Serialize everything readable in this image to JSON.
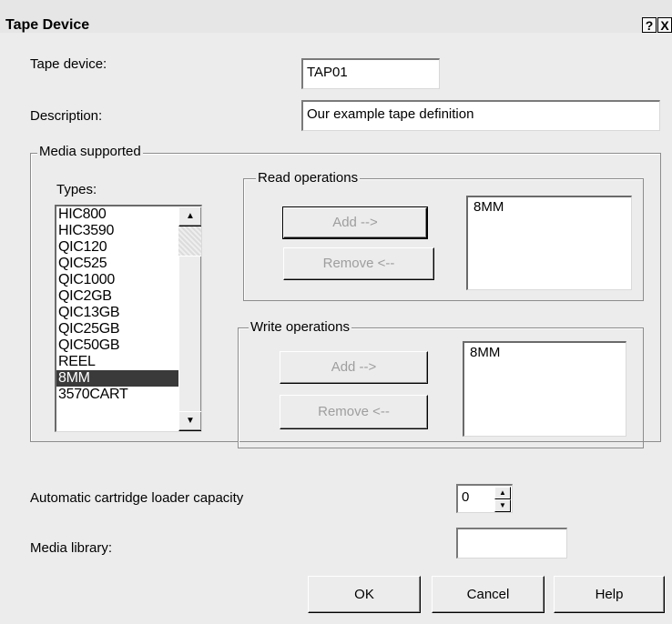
{
  "dialog": {
    "title": "Tape Device",
    "help_icon_glyph": "?",
    "close_icon_glyph": "X"
  },
  "form": {
    "tape_device_label": "Tape device:",
    "tape_device_value": "TAP01",
    "description_label": "Description:",
    "description_value": "Our example tape definition"
  },
  "media": {
    "group_label": "Media supported",
    "types_label": "Types:",
    "types": [
      "HIC800",
      "HIC3590",
      "QIC120",
      "QIC525",
      "QIC1000",
      "QIC2GB",
      "QIC13GB",
      "QIC25GB",
      "QIC50GB",
      "REEL",
      "8MM",
      "3570CART"
    ],
    "selected_type": "8MM",
    "scroll_up_glyph": "▲",
    "scroll_down_glyph": "▼",
    "read": {
      "group_label": "Read operations",
      "add_label": "Add -->",
      "remove_label": "Remove <--",
      "items": [
        "8MM"
      ]
    },
    "write": {
      "group_label": "Write operations",
      "add_label": "Add -->",
      "remove_label": "Remove <--",
      "items": [
        "8MM"
      ]
    }
  },
  "loader": {
    "label": "Automatic cartridge loader capacity",
    "value": "0",
    "spin_up_glyph": "▲",
    "spin_down_glyph": "▼"
  },
  "library": {
    "label": "Media library:",
    "value": ""
  },
  "buttons": {
    "ok": "OK",
    "cancel": "Cancel",
    "help": "Help"
  },
  "colors": {
    "dialog_bg": "#ececec",
    "selection_bg": "#3a3a3a",
    "disabled_text": "#9e9e9e"
  }
}
